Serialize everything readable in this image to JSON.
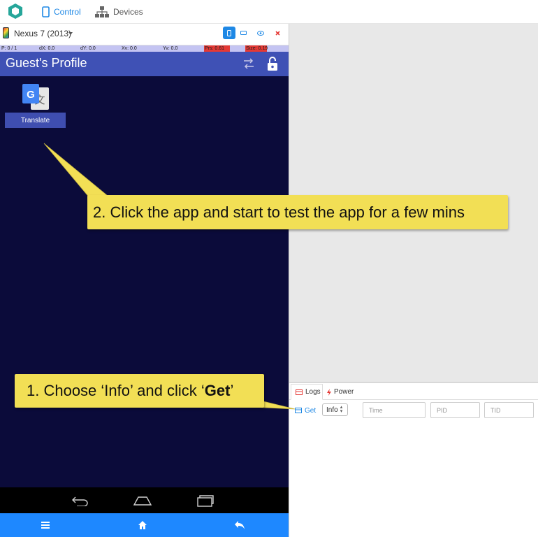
{
  "nav": {
    "control_label": "Control",
    "devices_label": "Devices"
  },
  "device": {
    "name": "Nexus 7 (2013)"
  },
  "pointer_info": {
    "p": "P: 0 / 1",
    "dx": "dX: 0.0",
    "dy": "dY: 0.0",
    "xv": "Xv: 0.0",
    "yv": "Yv: 0.0",
    "prs": "Prs: 0.61",
    "size": "Size: 0.19"
  },
  "screen": {
    "title": "Guest's Profile",
    "app_label": "Translate"
  },
  "logs_panel": {
    "tab_logs": "Logs",
    "tab_power": "Power",
    "get_label": "Get",
    "level_value": "Info",
    "time_placeholder": "Time",
    "pid_placeholder": "PID",
    "tid_placeholder": "TID"
  },
  "callouts": {
    "step2": "2. Click the app and start to test the app for a few mins",
    "step1_prefix": "1. Choose ‘Info’ and click ‘",
    "step1_bold": "Get",
    "step1_suffix": "’"
  },
  "colors": {
    "accent": "#1e88e5",
    "app_bar": "#3f51b5",
    "screen_bg": "#0b0b3a",
    "callout": "#f2df55",
    "bottom_bar": "#1e88ff"
  }
}
